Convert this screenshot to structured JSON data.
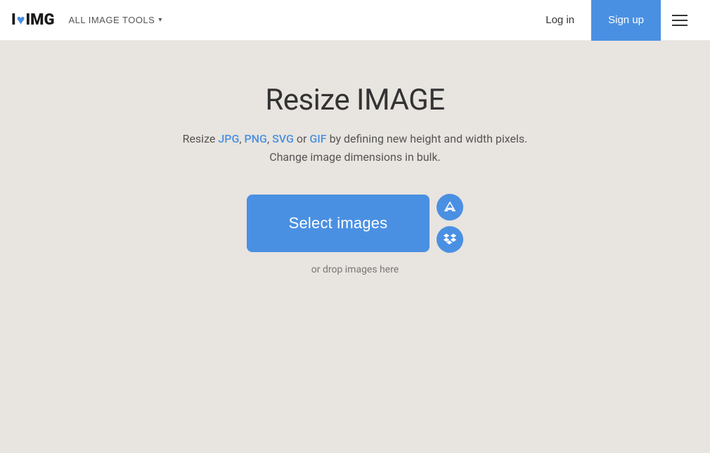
{
  "header": {
    "logo_i": "I",
    "logo_heart": "♥",
    "logo_img": "IMG",
    "all_tools_label": "ALL IMAGE TOOLS",
    "login_label": "Log in",
    "signup_label": "Sign up"
  },
  "main": {
    "title": "Resize IMAGE",
    "subtitle_prefix": "Resize ",
    "format_jpg": "JPG",
    "subtitle_comma1": ", ",
    "format_png": "PNG",
    "subtitle_comma2": ", ",
    "format_svg": "SVG",
    "subtitle_or": " or ",
    "format_gif": "GIF",
    "subtitle_suffix": " by defining new height and width pixels.",
    "subtitle_line2": "Change image dimensions in bulk.",
    "select_btn_label": "Select images",
    "drop_text": "or drop images here"
  },
  "icons": {
    "google_drive": "google-drive-icon",
    "dropbox": "dropbox-icon",
    "menu": "hamburger-menu-icon"
  }
}
